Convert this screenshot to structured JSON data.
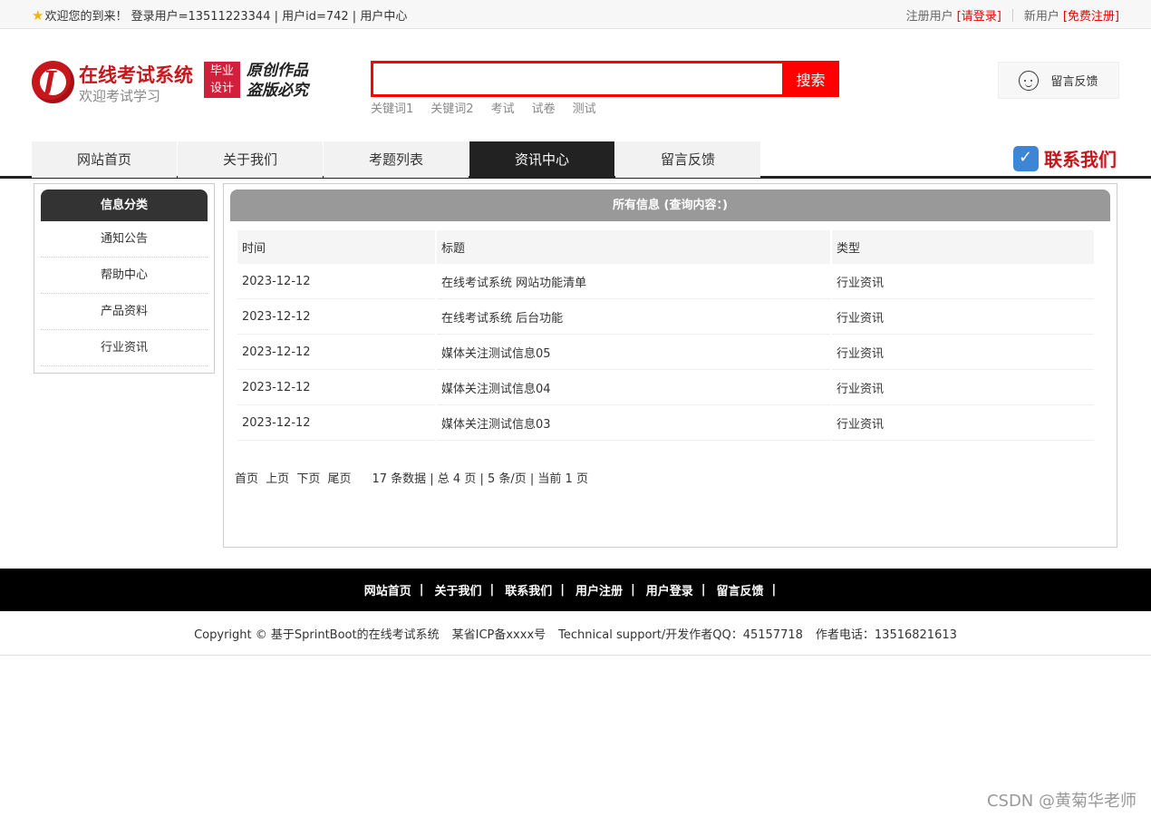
{
  "topbar": {
    "welcome": "欢迎您的到来！ 登录用户=13511223344 | 用户id=742 | 用户中心",
    "registered_label": "注册用户",
    "login_link": "[请登录]",
    "new_user_label": "新用户",
    "register_link": "[免费注册]"
  },
  "logo": {
    "name": "在线考试系统",
    "subtitle": "欢迎考试学习",
    "badge_line1": "毕业",
    "badge_line2": "设计",
    "motto_line1": "原创作品",
    "motto_line2": "盗版必究"
  },
  "search": {
    "value": "",
    "button": "搜索",
    "keywords": [
      "关键词1",
      "关键词2",
      "考试",
      "试卷",
      "测试"
    ]
  },
  "feedback_button": "留言反馈",
  "nav": {
    "items": [
      {
        "label": "网站首页",
        "active": false
      },
      {
        "label": "关于我们",
        "active": false
      },
      {
        "label": "考题列表",
        "active": false
      },
      {
        "label": "资讯中心",
        "active": true
      },
      {
        "label": "留言反馈",
        "active": false
      }
    ],
    "contact": "联系我们"
  },
  "sidebar": {
    "title": "信息分类",
    "items": [
      "通知公告",
      "帮助中心",
      "产品资料",
      "行业资讯"
    ]
  },
  "content": {
    "title": "所有信息 (查询内容：)",
    "columns": [
      "时间",
      "标题",
      "类型"
    ],
    "rows": [
      [
        "2023-12-12",
        "在线考试系统 网站功能清单",
        "行业资讯"
      ],
      [
        "2023-12-12",
        "在线考试系统 后台功能",
        "行业资讯"
      ],
      [
        "2023-12-12",
        "媒体关注测试信息05",
        "行业资讯"
      ],
      [
        "2023-12-12",
        "媒体关注测试信息04",
        "行业资讯"
      ],
      [
        "2023-12-12",
        "媒体关注测试信息03",
        "行业资讯"
      ]
    ],
    "pager": {
      "first": "首页",
      "prev": "上页",
      "next": "下页",
      "last": "尾页",
      "info": "17 条数据 | 总 4 页 | 5 条/页 | 当前 1 页"
    }
  },
  "footer": {
    "links": [
      "网站首页",
      "关于我们",
      "联系我们",
      "用户注册",
      "用户登录",
      "留言反馈"
    ],
    "copyright": "Copyright © 基于SprintBoot的在线考试系统",
    "icp": "某省ICP备xxxx号",
    "support": "Technical support/开发作者QQ：45157718",
    "phone": "作者电话：13516821613"
  },
  "watermark": "CSDN @黄菊华老师"
}
